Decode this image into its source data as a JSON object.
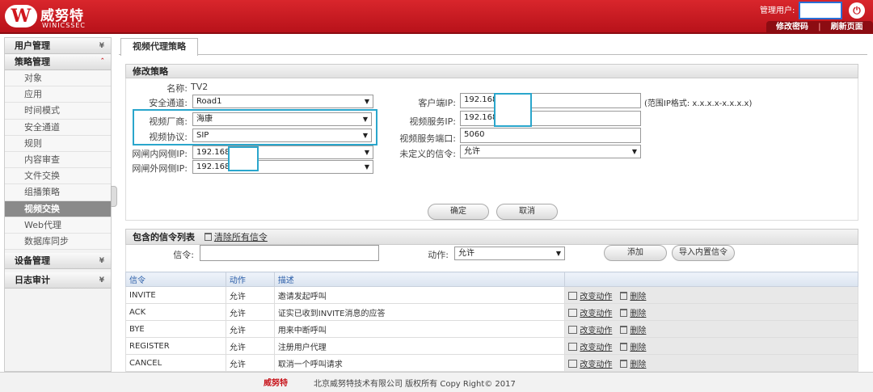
{
  "header": {
    "logo_mark": "W",
    "brand_cn": "威努特",
    "brand_en": "WINICSSEC",
    "admin_label": "管理用户:",
    "links": [
      "修改密码",
      "刷新页面"
    ]
  },
  "sidebar": {
    "groups": [
      {
        "label": "用户管理"
      },
      {
        "label": "策略管理",
        "items": [
          "对象",
          "应用",
          "时间模式",
          "安全通道",
          "规则",
          "内容审查",
          "文件交换",
          "组播策略",
          "视频交换",
          "Web代理",
          "数据库同步"
        ]
      },
      {
        "label": "设备管理"
      },
      {
        "label": "日志审计"
      }
    ]
  },
  "tab": "视频代理策略",
  "form": {
    "title": "修改策略",
    "name_label": "名称:",
    "name_value": "TV2",
    "channel_label": "安全通道:",
    "channel_value": "Road1",
    "vendor_label": "视频厂商:",
    "vendor_value": "海康",
    "protocol_label": "视频协议:",
    "protocol_value": "SIP",
    "inner_ip_label": "网闸内网侧IP:",
    "inner_ip_value": "192.168",
    "outer_ip_label": "网闸外网侧IP:",
    "outer_ip_value": "192.168",
    "client_ip_label": "客户端IP:",
    "client_ip_value": "192.168.",
    "range_hint": "(范围IP格式: x.x.x.x-x.x.x.x)",
    "server_ip_label": "视频服务IP:",
    "server_ip_value": "192.168.",
    "port_label": "视频服务端口:",
    "port_value": "5060",
    "undefined_label": "未定义的信令:",
    "undefined_value": "允许",
    "confirm": "确定",
    "cancel": "取消"
  },
  "signal_list": {
    "title": "包含的信令列表",
    "clear_link": "清除所有信令",
    "signal_label": "信令:",
    "signal_value": "",
    "action_label": "动作:",
    "action_value": "允许",
    "add": "添加",
    "import": "导入内置信令",
    "columns": [
      "信令",
      "动作",
      "描述",
      ""
    ],
    "op_change": "改变动作",
    "op_delete": "删除",
    "rows": [
      {
        "signal": "INVITE",
        "action": "允许",
        "desc": "邀请发起呼叫"
      },
      {
        "signal": "ACK",
        "action": "允许",
        "desc": "证实已收到INVITE消息的应答"
      },
      {
        "signal": "BYE",
        "action": "允许",
        "desc": "用来中断呼叫"
      },
      {
        "signal": "REGISTER",
        "action": "允许",
        "desc": "注册用户代理"
      },
      {
        "signal": "CANCEL",
        "action": "允许",
        "desc": "取消一个呼叫请求"
      }
    ]
  },
  "footer": {
    "logo": "威努特",
    "text": "北京威努特技术有限公司 版权所有 Copy Right© 2017"
  },
  "colors": {
    "brand_red": "#c8161d",
    "highlight_blue": "#2aa6cc",
    "header_link_blue": "#2a5da8"
  }
}
